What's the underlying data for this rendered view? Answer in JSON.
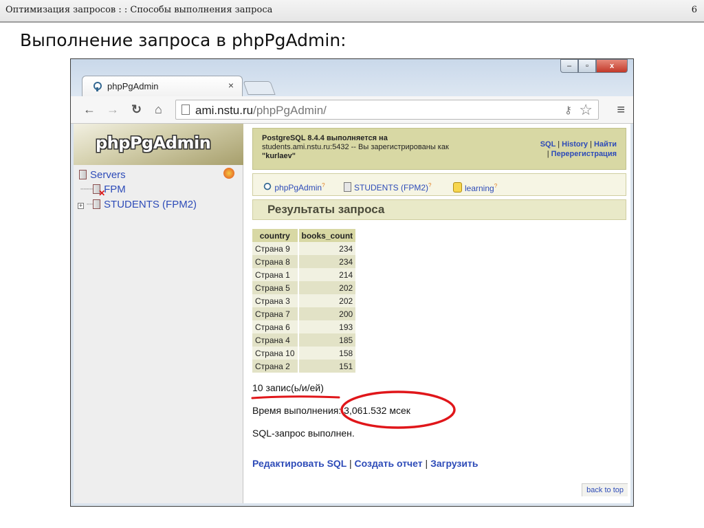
{
  "slide": {
    "breadcrumb": "Оптимизация запросов : : Способы выполнения запроса",
    "page_number": "6",
    "title": "Выполнение запроса в phpPgAdmin:"
  },
  "browser": {
    "tab_title": "phpPgAdmin",
    "tab_close": "×",
    "url_host": "ami.nstu.ru",
    "url_path": "/phpPgAdmin/",
    "window_controls": [
      "–",
      "▫",
      "x"
    ]
  },
  "sidebar": {
    "logo": "phpPgAdmin",
    "servers_label": "Servers",
    "items": [
      {
        "label": "FPM"
      },
      {
        "label": "STUDENTS (FPM2)"
      }
    ]
  },
  "header": {
    "info_line1": "PostgreSQL 8.4.4 выполняется на",
    "info_line2": "students.ami.nstu.ru:5432 -- Вы зарегистрированы как",
    "info_line3": "\"kurlaev\"",
    "link_sql": "SQL",
    "link_history": "History",
    "link_find": "Найти",
    "link_reregister": "Перерегистрация"
  },
  "trail": {
    "home": "phpPgAdmin",
    "server": "STUDENTS (FPM2)",
    "database": "learning",
    "help_mark": "?"
  },
  "page": {
    "section_title": "Результаты запроса",
    "rows_count": "10 запис(ь/и/ей)",
    "exec_time": "Время выполнения: 3,061.532 мсек",
    "sql_done": "SQL-запрос выполнен.",
    "action_edit": "Редактировать SQL",
    "action_report": "Создать отчет",
    "action_download": "Загрузить",
    "back_to_top": "back to top"
  },
  "results": {
    "columns": [
      "country",
      "books_count"
    ],
    "rows": [
      [
        "Страна 9",
        "234"
      ],
      [
        "Страна 8",
        "234"
      ],
      [
        "Страна 1",
        "214"
      ],
      [
        "Страна 5",
        "202"
      ],
      [
        "Страна 3",
        "202"
      ],
      [
        "Страна 7",
        "200"
      ],
      [
        "Страна 6",
        "193"
      ],
      [
        "Страна 4",
        "185"
      ],
      [
        "Страна 10",
        "158"
      ],
      [
        "Страна 2",
        "151"
      ]
    ]
  },
  "annotations": {
    "highlight_color": "#e0161a"
  }
}
